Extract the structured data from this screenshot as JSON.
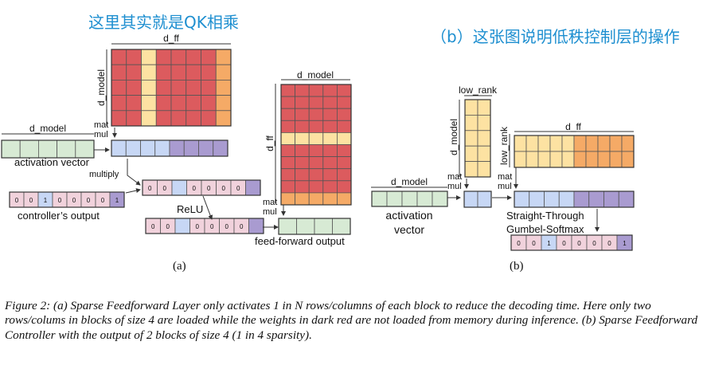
{
  "annotations": {
    "top_left": "这里其实就是QK相乘",
    "top_right": "（b）这张图说明低秩控制层的操作"
  },
  "panel_a": {
    "dim_dff_top": "d_ff",
    "dim_dmodel_left": "d_model",
    "dim_dmodel_vector": "d_model",
    "dim_dmodel_right": "d_model",
    "dim_dff_right": "d_ff",
    "matmul_1": [
      "mat",
      "mul"
    ],
    "matmul_2": [
      "mat",
      "mul"
    ],
    "activation_vector": "activation vector",
    "multiply": "multiply",
    "controller_output": "controller’s output",
    "relu": "ReLU",
    "feed_forward_output": "feed-forward output",
    "controller_bits": [
      "0",
      "0",
      "1",
      "0",
      "0",
      "0",
      "0",
      "1"
    ],
    "multiplied_bits": [
      "0",
      "0",
      "",
      "0",
      "0",
      "0",
      "0",
      ""
    ],
    "relu_bits": [
      "0",
      "0",
      "",
      "0",
      "0",
      "0",
      "0",
      ""
    ],
    "sublabel": "(a)"
  },
  "panel_b": {
    "low_rank_top": "low_rank",
    "d_model_vertical": "d_model",
    "low_rank_vertical": "low_rank",
    "dim_dff": "d_ff",
    "dim_dmodel": "d_model",
    "matmul_1": [
      "mat",
      "mul"
    ],
    "matmul_2": [
      "mat",
      "mul"
    ],
    "activation_vector": [
      "activation",
      "vector"
    ],
    "straight_through": [
      "Straight-Through",
      "Gumbel-Softmax"
    ],
    "output_bits": [
      "0",
      "0",
      "1",
      "0",
      "0",
      "0",
      "0",
      "1"
    ],
    "sublabel": "(b)"
  },
  "caption": "Figure 2: (a) Sparse Feedforward Layer only activates 1 in N rows/columns of each block to reduce the decoding time. Here only two rows/colums in blocks of size 4 are loaded while the weights in dark red are not loaded from memory during inference. (b) Sparse Feedforward Controller with the output of 2 blocks of size 4 (1 in 4 sparsity).",
  "colors": {
    "red": "#dc5b5e",
    "yellow": "#fde2a2",
    "orange": "#f5aa66",
    "green": "#d7ead4",
    "blue": "#c7d7f5",
    "purple": "#a99bd0",
    "pink": "#f1d2dc",
    "annotation": "#1e8fd0"
  }
}
